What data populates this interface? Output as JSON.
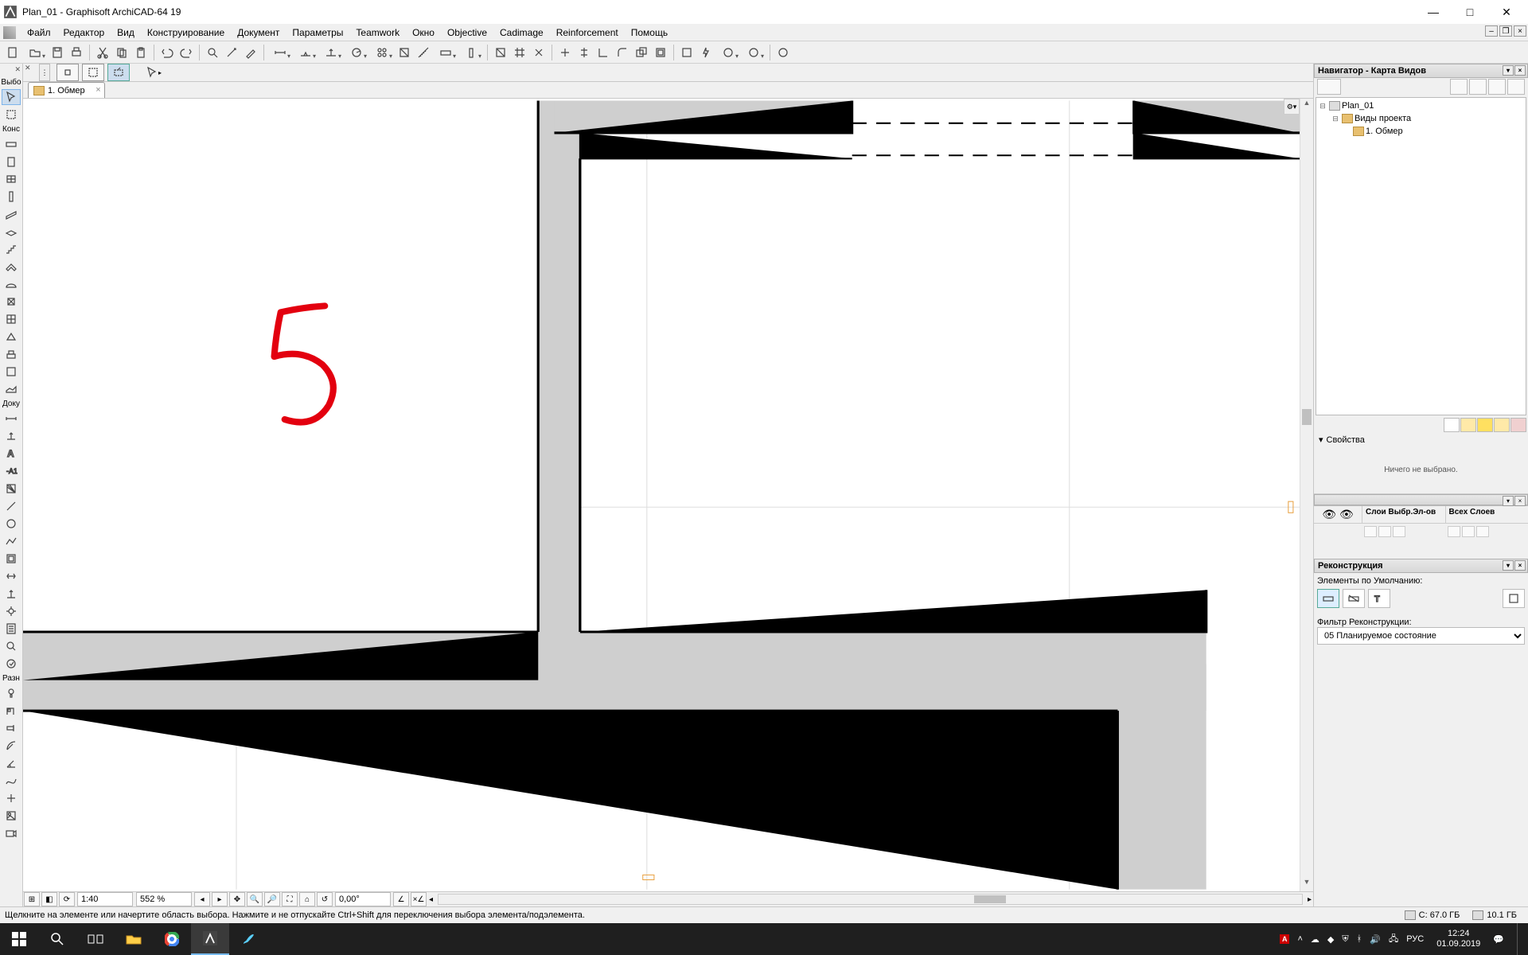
{
  "window": {
    "title": "Plan_01 - Graphisoft ArchiCAD-64 19"
  },
  "menu": {
    "items": [
      "Файл",
      "Редактор",
      "Вид",
      "Конструирование",
      "Документ",
      "Параметры",
      "Teamwork",
      "Окно",
      "Objective",
      "Cadimage",
      "Reinforcement",
      "Помощь"
    ]
  },
  "left_panel": {
    "section1": "Выбо",
    "section2": "Конс",
    "section3": "Доку",
    "section4": "Разн"
  },
  "tab": {
    "label": "1. Обмер"
  },
  "canvas": {
    "red_mark": "5"
  },
  "statusbar": {
    "scale": "1:40",
    "zoom": "552 %",
    "angle": "0,00°"
  },
  "navigator": {
    "title": "Навигатор - Карта Видов",
    "tree": {
      "root": "Plan_01",
      "folder": "Виды проекта",
      "item": "1. Обмер"
    }
  },
  "properties": {
    "title": "Свойства",
    "empty": "Ничего не выбрано."
  },
  "layers": {
    "col1": "Слои Выбр.Эл-ов",
    "col2": "Всех Слоев"
  },
  "reconstruction": {
    "title": "Реконструкция",
    "defaults_label": "Элементы по Умолчанию:",
    "filter_label": "Фильтр Реконструкции:",
    "filter_value": "05 Планируемое состояние"
  },
  "hint": {
    "text": "Щелкните на элементе или начертите область выбора. Нажмите и не отпускайте Ctrl+Shift для переключения выбора элемента/подэлемента.",
    "disk_c": "C: 67.0 ГБ",
    "disk_d": "10.1 ГБ"
  },
  "taskbar": {
    "lang": "РУС",
    "time": "12:24",
    "date": "01.09.2019"
  }
}
